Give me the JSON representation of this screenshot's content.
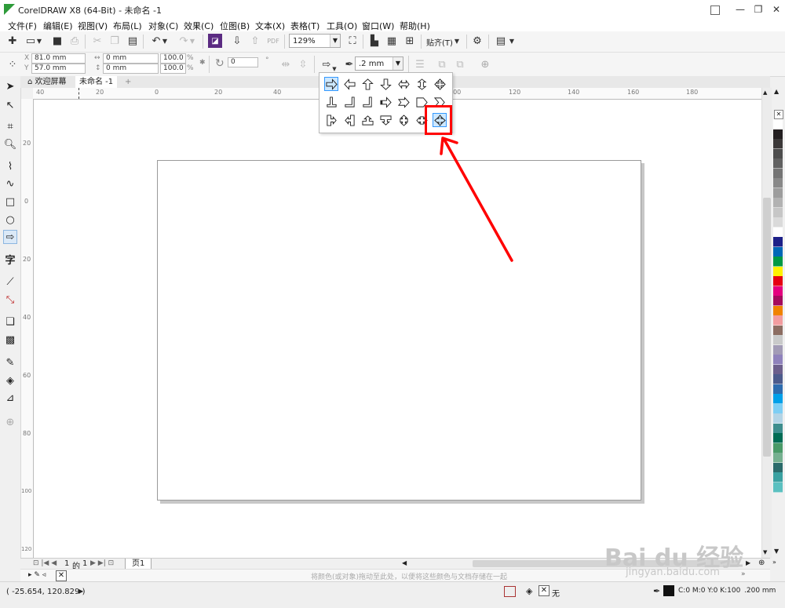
{
  "window": {
    "title": "CorelDRAW X8 (64-Bit) - 未命名 -1",
    "controls": [
      "▣",
      "—",
      "❐",
      "✕"
    ]
  },
  "menu": [
    "文件(F)",
    "编辑(E)",
    "视图(V)",
    "布局(L)",
    "对象(C)",
    "效果(C)",
    "位图(B)",
    "文本(X)",
    "表格(T)",
    "工具(O)",
    "窗口(W)",
    "帮助(H)"
  ],
  "toolbar": {
    "zoom_value": "129%",
    "snap_label": "贴齐(T)"
  },
  "property_bar": {
    "x_value": "81.0 mm",
    "y_value": "57.0 mm",
    "width_value": "0 mm",
    "height_value": "0 mm",
    "scale_x": "100.0",
    "scale_y": "100.0",
    "percent": "%",
    "rotation_value": "0",
    "outline_width": ".2 mm"
  },
  "tabs": {
    "welcome": "欢迎屏幕",
    "document": "未命名 -1",
    "add": "+"
  },
  "ruler": {
    "h_numbers": [
      "40",
      "20",
      "0",
      "20",
      "40",
      "60",
      "80",
      "100",
      "120",
      "140",
      "160",
      "180"
    ],
    "v_numbers": [
      "20",
      "0",
      "20",
      "40",
      "60",
      "80",
      "100",
      "120",
      "140",
      "160"
    ]
  },
  "page_nav": {
    "current": "1",
    "of": "的",
    "total": "1",
    "page_tab": "页1"
  },
  "color_bar_hint": "将颜色(或对象)拖动至此处，以便将这些颜色与文档存储在一起",
  "status": {
    "coordinates": "( -25.654, 120.829 )",
    "fill_none": "无",
    "outline_color": "C:0 M:0 Y:0 K:100",
    "outline_width": ".200 mm"
  },
  "watermark": {
    "brand": "Bai du 经验",
    "url": "jingyan.baidu.com"
  },
  "colors": {
    "accent_red": "#ff0000",
    "selected_blue": "#3399ff",
    "palette": [
      "#ffffff",
      "#231f20",
      "#3b3838",
      "#4d4d4d",
      "#616161",
      "#757575",
      "#898989",
      "#9d9d9d",
      "#b2b2b2",
      "#c6c6c6",
      "#dadada",
      "#ffffff",
      "#1d2088",
      "#0068b7",
      "#009944",
      "#fff100",
      "#e60012",
      "#e4007f",
      "#a40b5d",
      "#f08300",
      "#f29c9f",
      "#8c6d62",
      "#c9caca",
      "#a29bb6",
      "#8f82bc",
      "#6c5f8c",
      "#4c5b8c",
      "#2e6cae",
      "#00a0e9",
      "#7ecef4",
      "#b3d4e6",
      "#3e8e8e",
      "#006c54",
      "#4a9a68",
      "#76b090",
      "#2b6b6b",
      "#3aa1a1",
      "#5bc0c0"
    ]
  }
}
